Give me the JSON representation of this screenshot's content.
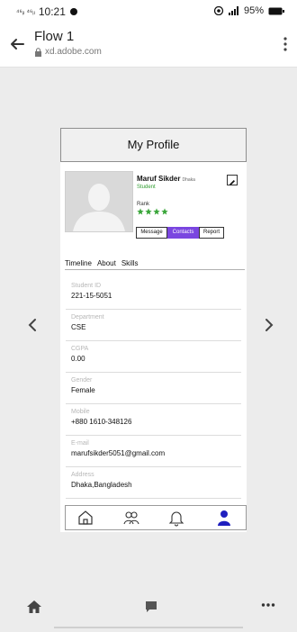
{
  "status": {
    "signal_left": "⁴⁶ᵢₗ ⁴⁶ᵢₗ",
    "time": "10:21",
    "battery": "95%"
  },
  "browser": {
    "title": "Flow 1",
    "url": "xd.adobe.com"
  },
  "profile": {
    "header": "My Profile",
    "name": "Maruf Sikder",
    "location": "Dhaka",
    "role": "Student",
    "rank_label": "Rank",
    "stars": 4,
    "buttons": {
      "message": "Message",
      "contacts": "Contacts",
      "report": "Report"
    },
    "tabs": [
      "Timeline",
      "About",
      "Skills"
    ],
    "fields": [
      {
        "label": "Student ID",
        "value": "221-15-5051"
      },
      {
        "label": "Department",
        "value": "CSE"
      },
      {
        "label": "CGPA",
        "value": "0.00"
      },
      {
        "label": "Gender",
        "value": "Female"
      },
      {
        "label": "Mobile",
        "value": "+880 1610-348126"
      },
      {
        "label": "E-mail",
        "value": "marufsikder5051@gmail.com"
      },
      {
        "label": "Address",
        "value": "Dhaka,Bangladesh"
      }
    ]
  },
  "colors": {
    "accent_purple": "#7a46e0",
    "star_green": "#3aa63a",
    "active_nav": "#1f1fbf"
  }
}
